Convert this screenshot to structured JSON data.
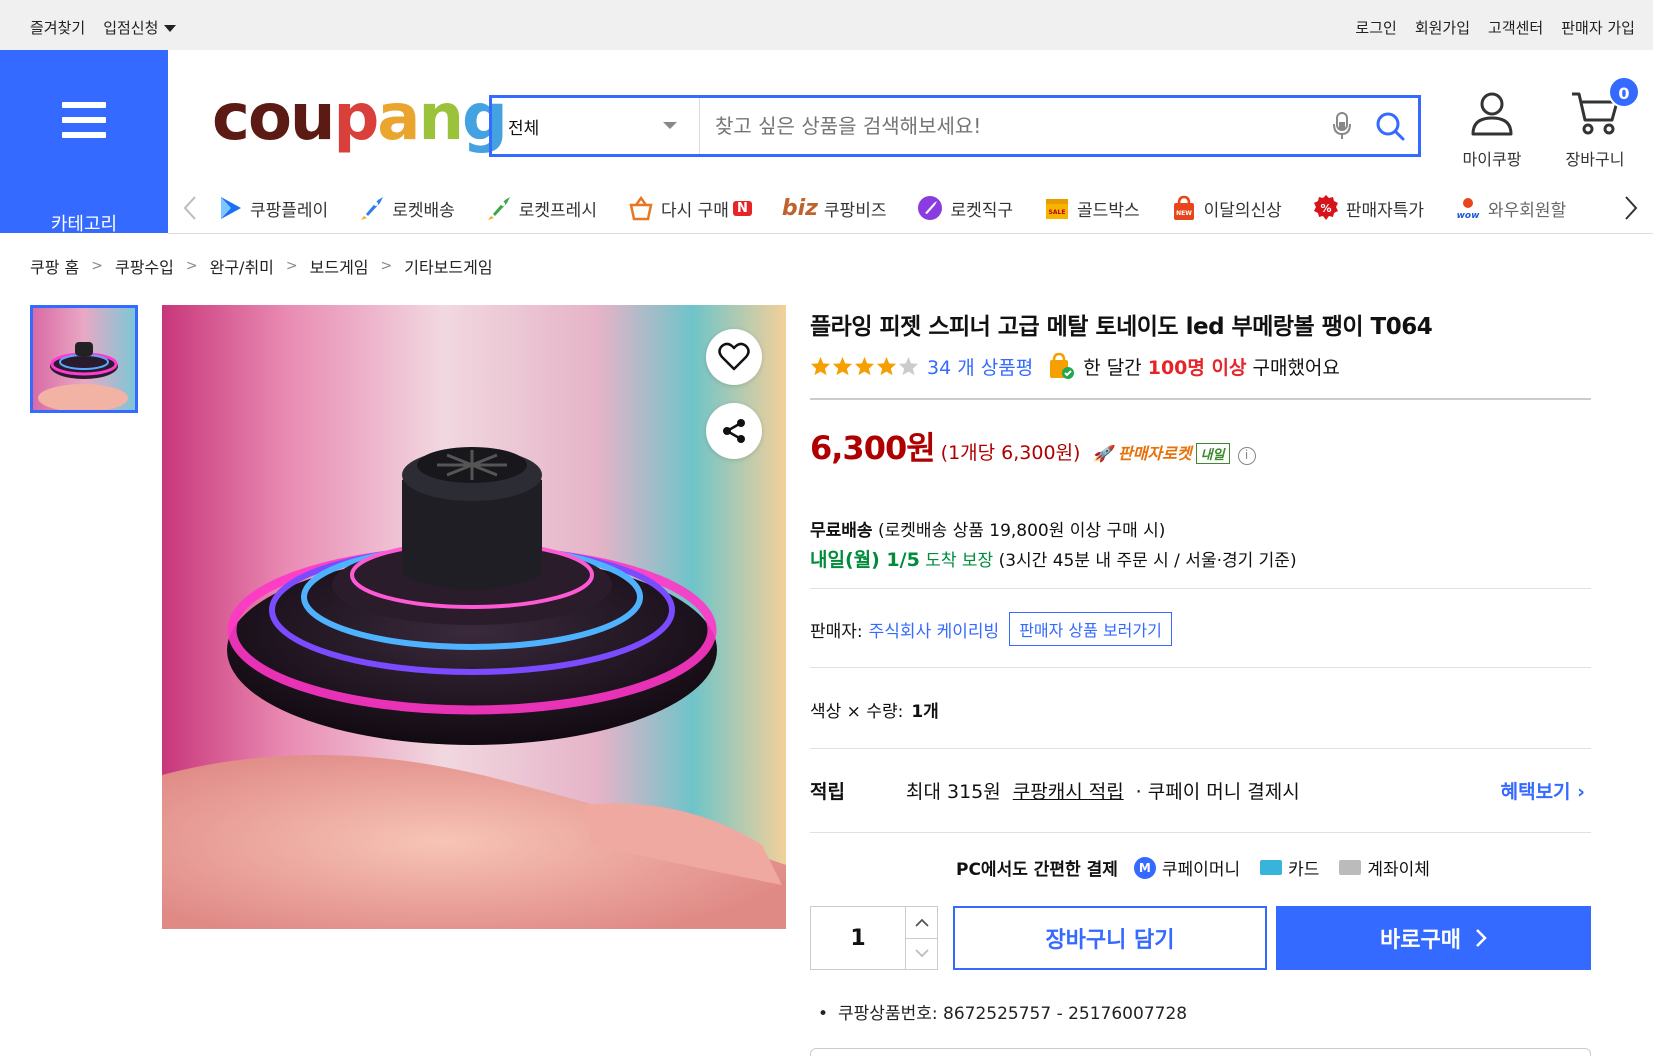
{
  "topbar": {
    "bookmark": "즐겨찾기",
    "seller_apply": "입점신청",
    "login": "로그인",
    "signup": "회원가입",
    "customer_center": "고객센터",
    "seller_join": "판매자 가입"
  },
  "header": {
    "category_label": "카테고리",
    "logo_text": [
      "cou",
      "p",
      "a",
      "n",
      "g"
    ],
    "search": {
      "category": "전체",
      "placeholder": "찾고 싶은 상품을 검색해보세요!"
    },
    "my_coupang": "마이쿠팡",
    "cart_label": "장바구니",
    "cart_count": "0"
  },
  "subnav": [
    {
      "label": "쿠팡플레이",
      "icon": "play-icon"
    },
    {
      "label": "로켓배송",
      "icon": "rocket-icon"
    },
    {
      "label": "로켓프레시",
      "icon": "rocket-fresh-icon"
    },
    {
      "label": "다시 구매",
      "icon": "rebuy-icon",
      "badge": "N"
    },
    {
      "label": "쿠팡비즈",
      "icon": "biz-icon",
      "prefix": "biz"
    },
    {
      "label": "로켓직구",
      "icon": "rocket-global-icon"
    },
    {
      "label": "골드박스",
      "icon": "goldbox-icon"
    },
    {
      "label": "이달의신상",
      "icon": "new-bag-icon"
    },
    {
      "label": "판매자특가",
      "icon": "seller-deal-icon"
    },
    {
      "label": "와우회원할",
      "icon": "wow-icon"
    }
  ],
  "breadcrumb": [
    "쿠팡 홈",
    "쿠팡수입",
    "완구/취미",
    "보드게임",
    "기타보드게임"
  ],
  "product": {
    "title": "플라잉 피젯 스피너 고급 메탈 토네이도 led 부메랑볼 팽이 T064",
    "rating": 4.5,
    "review_count": "34 개 상품평",
    "purchase_prefix": "한 달간",
    "purchase_count": "100명 이상",
    "purchase_suffix": "구매했어요",
    "price": "6,300원",
    "unit_price": "(1개당 6,300원)",
    "rocket_label": "판매자로켓",
    "tomorrow_tag": "내일",
    "free_ship_label": "무료배송",
    "free_ship_cond": "(로켓배송 상품 19,800원 이상 구매 시)",
    "arrival_date": "내일(월) 1/5",
    "arrival_guarantee": "도착 보장",
    "arrival_cond": "(3시간 45분 내 주문 시 / 서울·경기 기준)",
    "seller_label": "판매자:",
    "seller_name": "주식회사 케이리빙",
    "seller_button": "판매자 상품 보러가기",
    "option_label": "색상 × 수량:",
    "option_value": "1개",
    "reward_label": "적립",
    "reward_amount": "최대 315원",
    "reward_link": "쿠팡캐시 적립",
    "reward_cond": "· 쿠페이 머니 결제시",
    "reward_more": "혜택보기",
    "pay_title": "PC에서도 간편한 결제",
    "pay_money": "쿠페이머니",
    "pay_card": "카드",
    "pay_bank": "계좌이체",
    "quantity": "1",
    "add_to_cart": "장바구니 담기",
    "buy_now": "바로구매",
    "product_number": "쿠팡상품번호: 8672525757 - 25176007728"
  },
  "colors": {
    "accent": "#346aff",
    "price": "#ae0000",
    "green": "#008c3c"
  }
}
